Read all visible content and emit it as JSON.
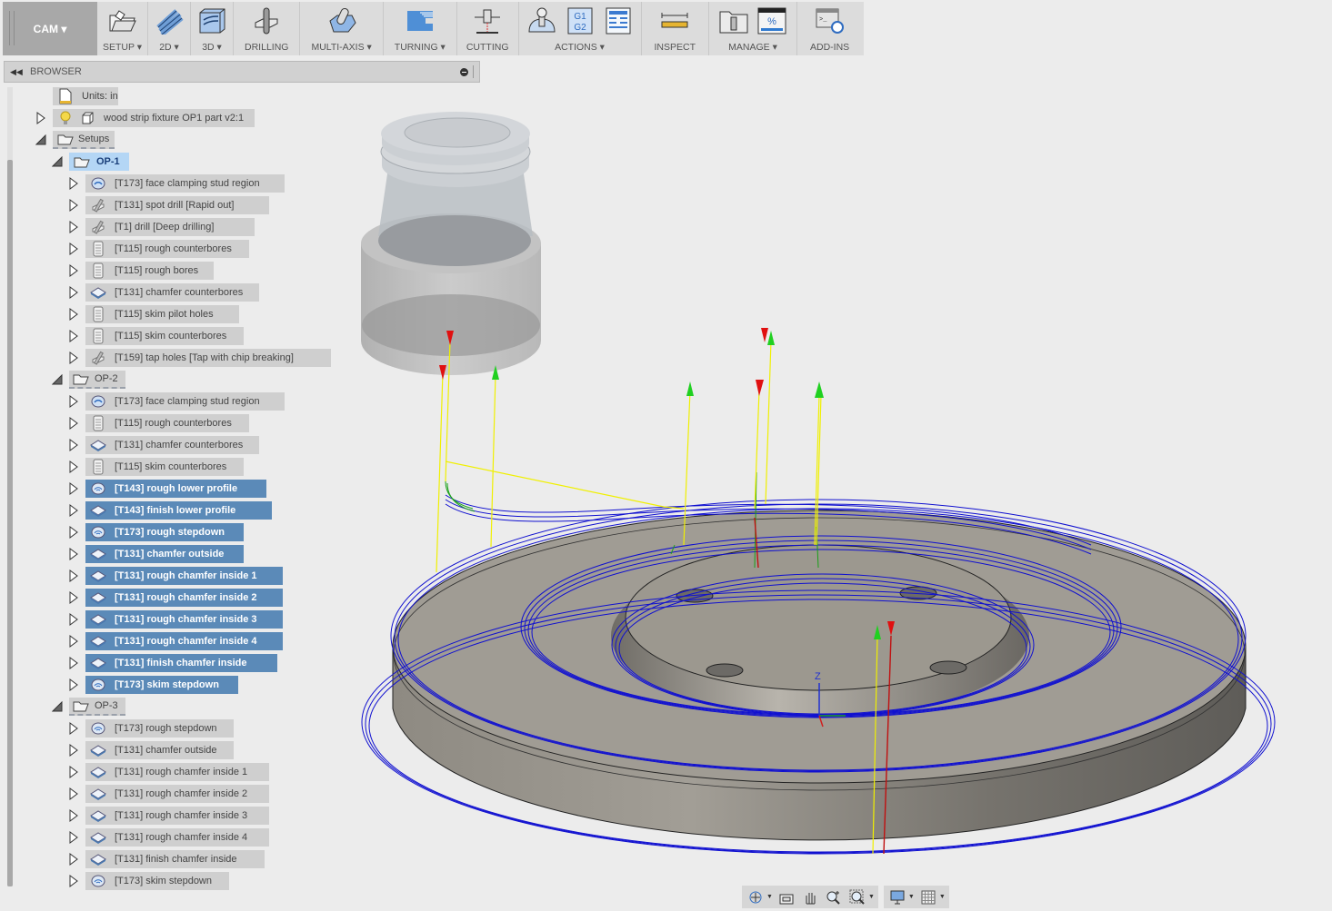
{
  "toolbar": {
    "workspace": "CAM ▾",
    "groups": [
      {
        "label": "SETUP ▾",
        "icons": [
          "setup-folder-icon"
        ]
      },
      {
        "label": "2D ▾",
        "icons": [
          "2d-toolpath-icon"
        ]
      },
      {
        "label": "3D ▾",
        "icons": [
          "3d-toolpath-icon"
        ]
      },
      {
        "label": "DRILLING",
        "icons": [
          "drilling-icon"
        ]
      },
      {
        "label": "MULTI-AXIS ▾",
        "icons": [
          "multi-axis-icon"
        ]
      },
      {
        "label": "TURNING ▾",
        "icons": [
          "turning-icon"
        ]
      },
      {
        "label": "CUTTING",
        "icons": [
          "cutting-icon"
        ]
      },
      {
        "label": "ACTIONS ▾",
        "icons": [
          "simulate-icon",
          "g1g2-post-process-icon",
          "setup-sheet-icon"
        ]
      },
      {
        "label": "INSPECT",
        "icons": [
          "measure-ruler-icon"
        ]
      },
      {
        "label": "MANAGE ▾",
        "icons": [
          "tool-library-icon",
          "task-manager-icon"
        ]
      },
      {
        "label": "ADD-INS",
        "icons": [
          "scripts-addins-icon"
        ]
      }
    ],
    "g1g2_text": "G1\nG2",
    "percent_text": "%"
  },
  "browser": {
    "title": "BROWSER",
    "units": "Units: in",
    "model": "wood strip fixture OP1 part v2:1",
    "setups_label": "Setups",
    "setups": [
      {
        "name": "OP-1",
        "state": "active",
        "operations": [
          {
            "label": "[T173] face clamping stud region",
            "icon": "face-icon",
            "selected": false
          },
          {
            "label": "[T131] spot drill [Rapid out]",
            "icon": "drill-icon",
            "selected": false
          },
          {
            "label": "[T1] drill [Deep drilling]",
            "icon": "drill-icon",
            "selected": false
          },
          {
            "label": "[T115] rough counterbores",
            "icon": "bore-icon",
            "selected": false
          },
          {
            "label": "[T115] rough bores",
            "icon": "bore-icon",
            "selected": false
          },
          {
            "label": "[T131] chamfer counterbores",
            "icon": "contour-icon",
            "selected": false
          },
          {
            "label": "[T115] skim pilot holes",
            "icon": "bore-icon",
            "selected": false
          },
          {
            "label": "[T115] skim counterbores",
            "icon": "bore-icon",
            "selected": false
          },
          {
            "label": "[T159] tap holes [Tap with chip breaking]",
            "icon": "drill-icon",
            "selected": false
          }
        ]
      },
      {
        "name": "OP-2",
        "state": "normal",
        "operations": [
          {
            "label": "[T173] face clamping stud region",
            "icon": "face-icon",
            "selected": false
          },
          {
            "label": "[T115] rough counterbores",
            "icon": "bore-icon",
            "selected": false
          },
          {
            "label": "[T131] chamfer counterbores",
            "icon": "contour-icon",
            "selected": false
          },
          {
            "label": "[T115] skim counterbores",
            "icon": "bore-icon",
            "selected": false
          },
          {
            "label": "[T143] rough lower profile",
            "icon": "adaptive-icon",
            "selected": true
          },
          {
            "label": "[T143] finish lower profile",
            "icon": "contour-icon",
            "selected": true
          },
          {
            "label": "[T173] rough  stepdown",
            "icon": "adaptive-icon",
            "selected": true
          },
          {
            "label": "[T131] chamfer outside",
            "icon": "contour-icon",
            "selected": true
          },
          {
            "label": "[T131] rough chamfer inside 1",
            "icon": "contour-icon",
            "selected": true
          },
          {
            "label": "[T131] rough chamfer inside 2",
            "icon": "contour-icon",
            "selected": true
          },
          {
            "label": "[T131] rough chamfer inside 3",
            "icon": "contour-icon",
            "selected": true
          },
          {
            "label": "[T131] rough chamfer inside 4",
            "icon": "contour-icon",
            "selected": true
          },
          {
            "label": "[T131] finish chamfer inside",
            "icon": "contour-icon",
            "selected": true
          },
          {
            "label": "[T173] skim  stepdown",
            "icon": "adaptive-icon",
            "selected": true
          }
        ]
      },
      {
        "name": "OP-3",
        "state": "normal",
        "operations": [
          {
            "label": "[T173] rough  stepdown",
            "icon": "adaptive-icon",
            "selected": false
          },
          {
            "label": "[T131] chamfer outside",
            "icon": "contour-icon",
            "selected": false
          },
          {
            "label": "[T131] rough chamfer inside 1",
            "icon": "contour-icon",
            "selected": false
          },
          {
            "label": "[T131] rough chamfer inside 2",
            "icon": "contour-icon",
            "selected": false
          },
          {
            "label": "[T131] rough chamfer inside 3",
            "icon": "contour-icon",
            "selected": false
          },
          {
            "label": "[T131] rough chamfer inside 4",
            "icon": "contour-icon",
            "selected": false
          },
          {
            "label": "[T131] finish chamfer inside",
            "icon": "contour-icon",
            "selected": false
          },
          {
            "label": "[T173] skim  stepdown",
            "icon": "adaptive-icon",
            "selected": false
          }
        ]
      }
    ]
  },
  "viewport": {
    "axis_z_label": "Z",
    "colors": {
      "toolpath": "#1010d0",
      "rapid": "#f0f000",
      "lead": "#18a018",
      "plunge": "#c01010",
      "part": "#a09c94",
      "tool": "#b4b4b4"
    }
  },
  "navbar": {
    "buttons": [
      "orbit-icon",
      "look-at-icon",
      "pan-hand-icon",
      "zoom-icon",
      "fit-zoom-window-icon",
      "display-settings-icon",
      "grid-settings-icon"
    ]
  }
}
